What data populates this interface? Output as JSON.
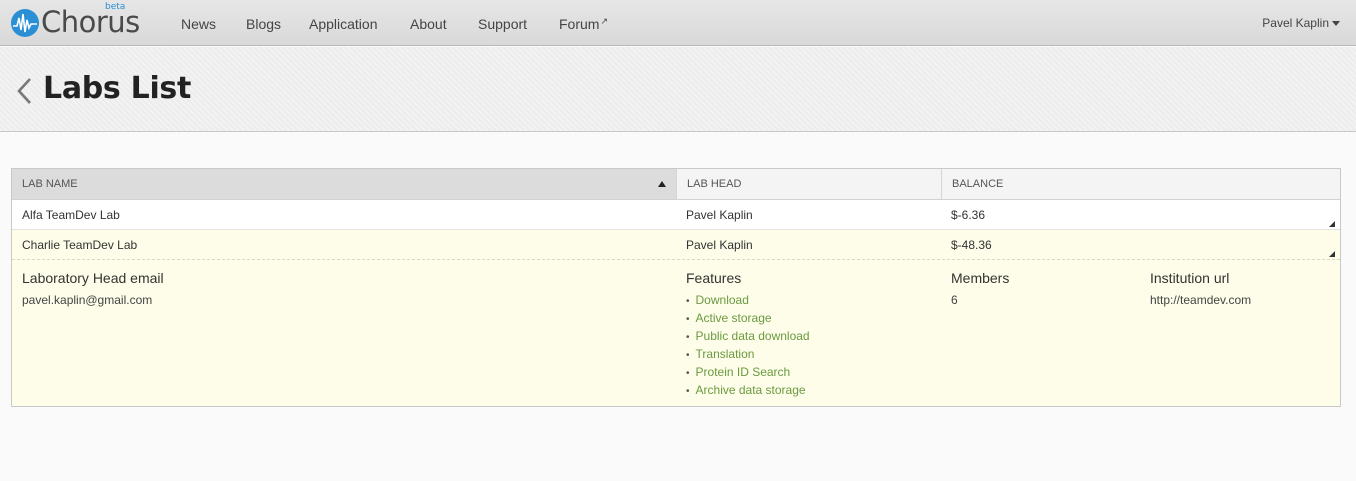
{
  "brand": {
    "name": "Chorus",
    "badge": "beta"
  },
  "nav": {
    "items": [
      "News",
      "Blogs",
      "Application",
      "About",
      "Support",
      "Forum"
    ],
    "forum_ext_icon": "external-link-icon"
  },
  "user": {
    "name": "Pavel Kaplin"
  },
  "page": {
    "title": "Labs List"
  },
  "table": {
    "columns": [
      "LAB NAME",
      "LAB HEAD",
      "BALANCE"
    ],
    "sort": {
      "column": "LAB NAME",
      "direction": "asc"
    },
    "rows": [
      {
        "name": "Alfa TeamDev Lab",
        "head": "Pavel Kaplin",
        "balance": "$-6.36"
      },
      {
        "name": "Charlie TeamDev Lab",
        "head": "Pavel Kaplin",
        "balance": "$-48.36"
      }
    ]
  },
  "details": {
    "email_label": "Laboratory Head email",
    "email": "pavel.kaplin@gmail.com",
    "features_label": "Features",
    "features": [
      "Download",
      "Active storage",
      "Public data download",
      "Translation",
      "Protein ID Search",
      "Archive data storage"
    ],
    "members_label": "Members",
    "members": "6",
    "institution_label": "Institution url",
    "institution": "http://teamdev.com"
  },
  "colors": {
    "accent": "#2a8fd4",
    "link": "#6b9a3f",
    "expanded_bg": "#fdfde9"
  }
}
